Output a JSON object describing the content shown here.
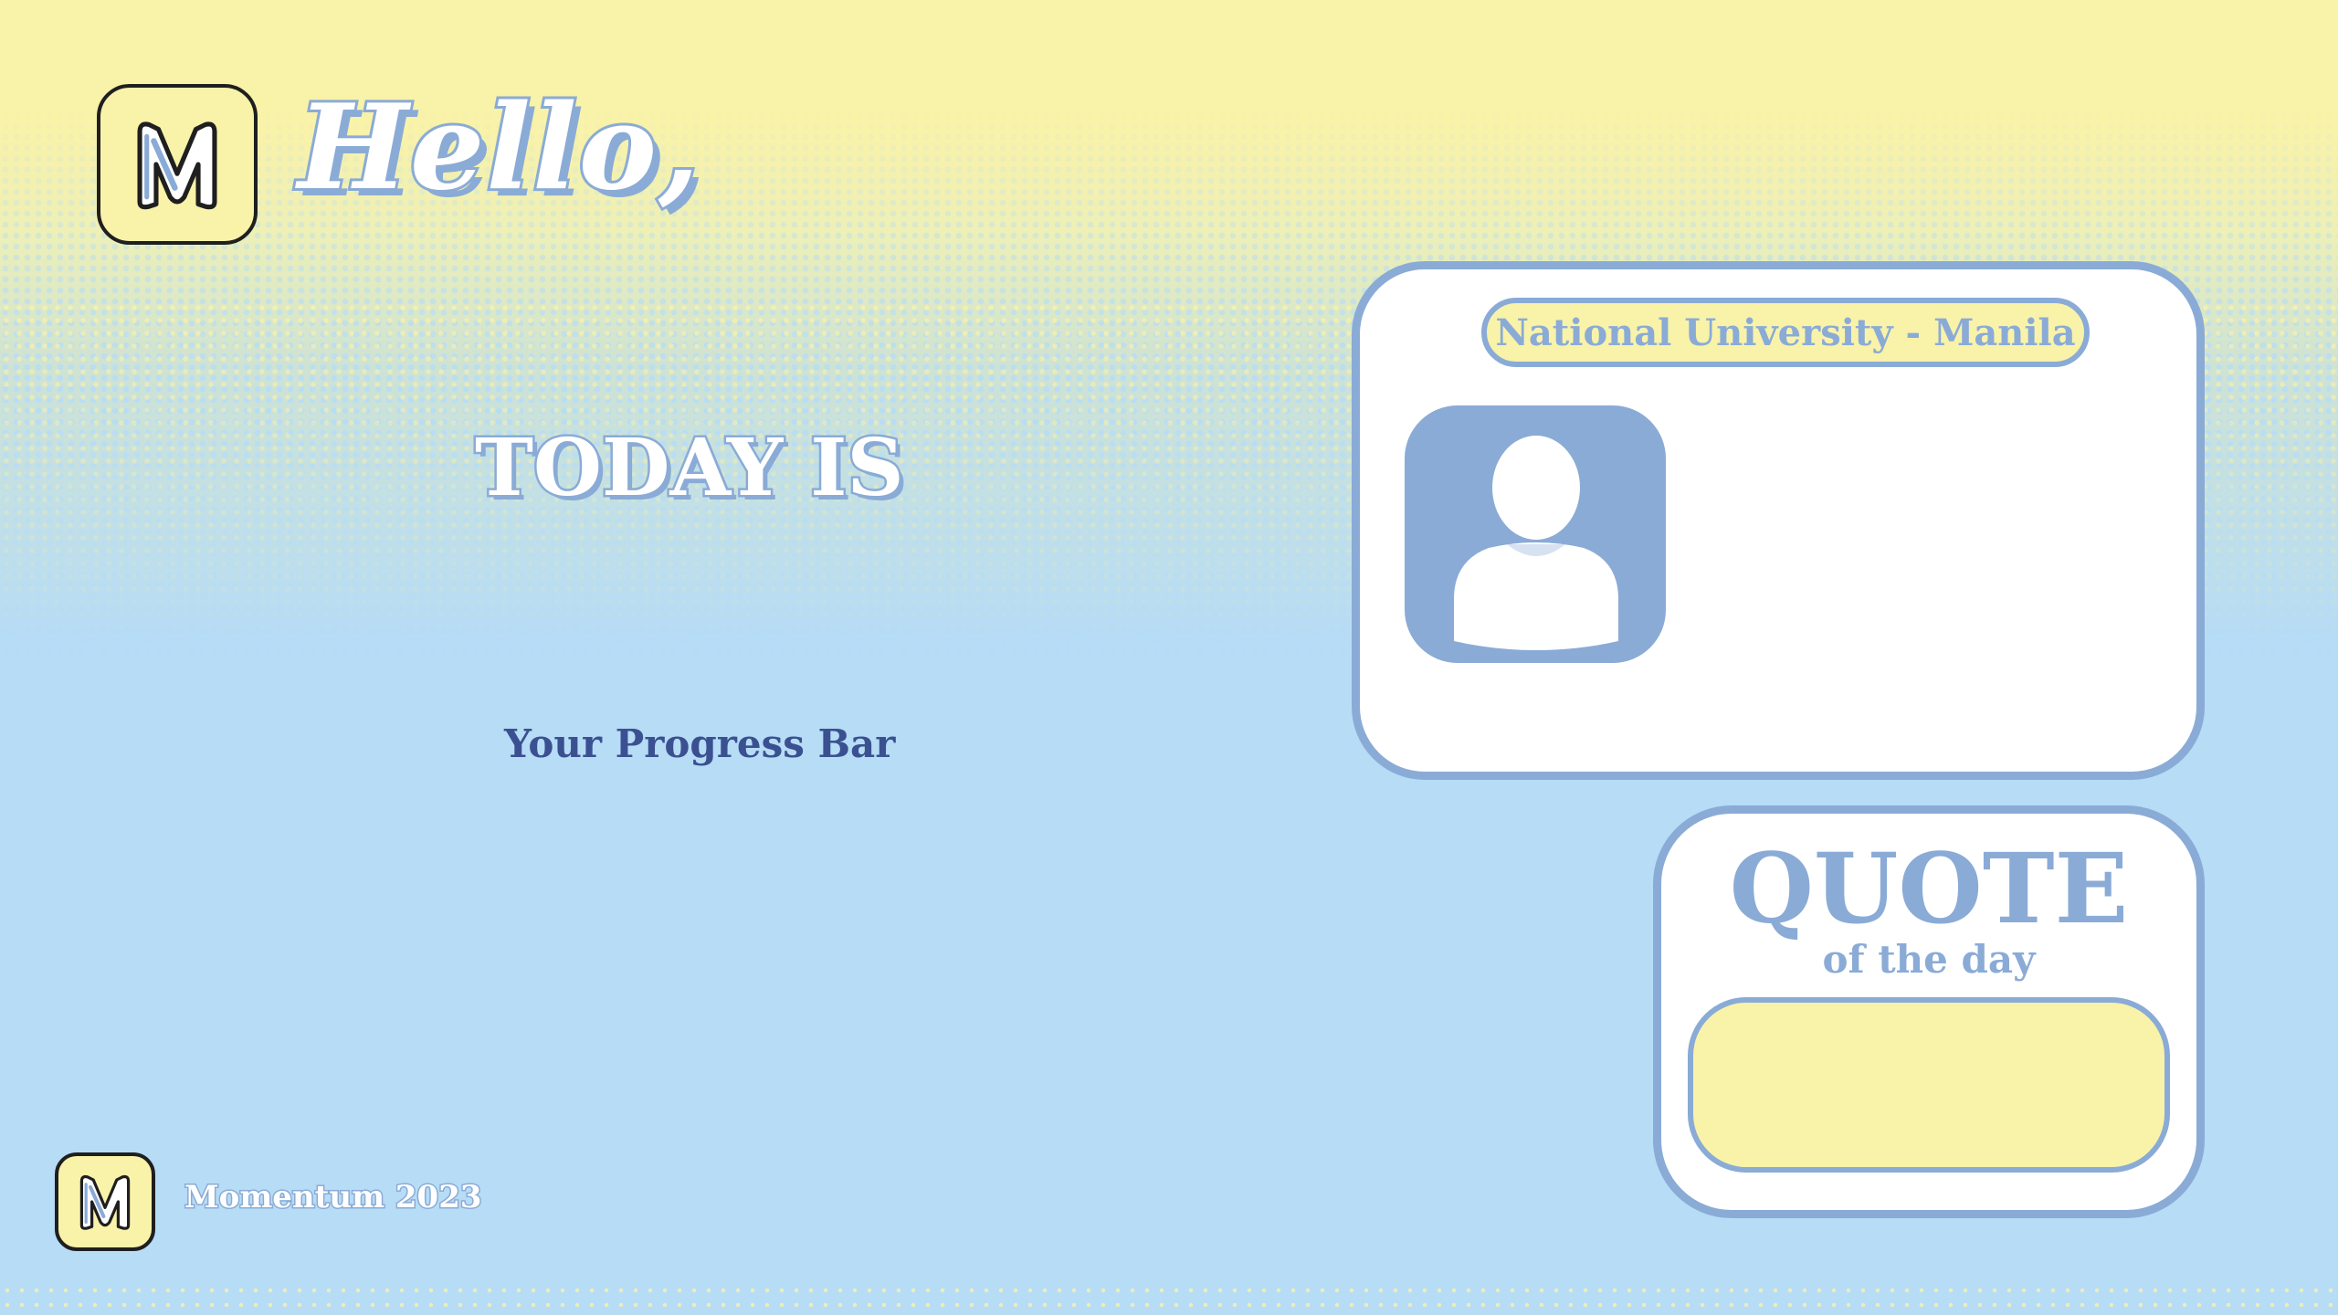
{
  "header": {
    "greeting": "Hello,"
  },
  "main": {
    "today_label": "TODAY IS",
    "progress_label": "Your Progress Bar"
  },
  "profile": {
    "university": "National University - Manila",
    "avatar_icon": "user-avatar-icon"
  },
  "quote": {
    "title": "QUOTE",
    "subtitle": "of the day"
  },
  "footer": {
    "text": "Momentum 2023"
  },
  "colors": {
    "yellow": "#f9f2a9",
    "sky": "#b6dcf6",
    "accent_blue": "#8aabd6",
    "navy": "#3b5090"
  },
  "icons": {
    "logo": "momentum-m-logo-icon"
  }
}
